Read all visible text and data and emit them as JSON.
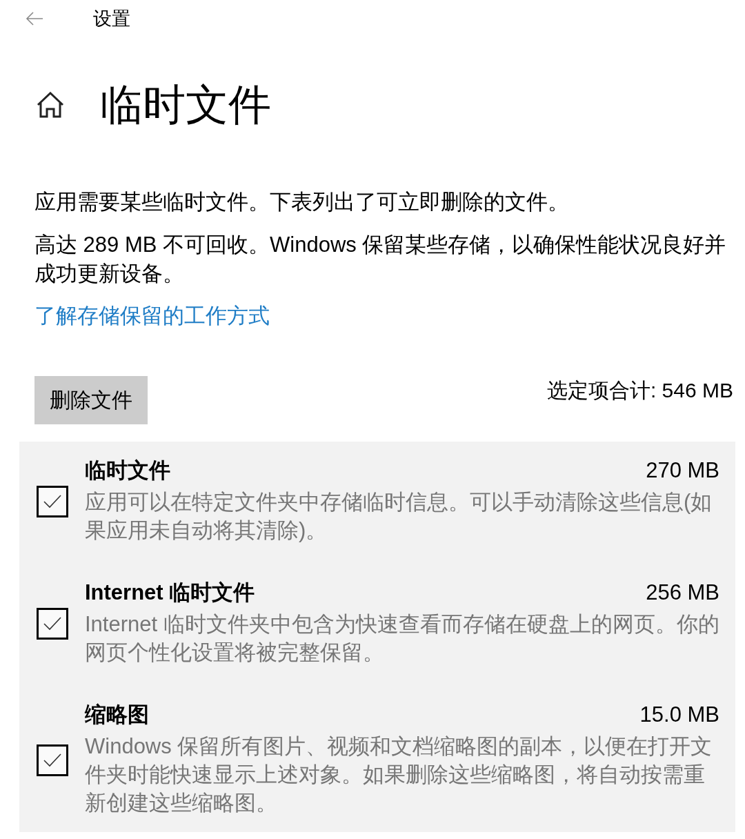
{
  "top_bar": {
    "title": "设置"
  },
  "page": {
    "title": "临时文件"
  },
  "intro": [
    "应用需要某些临时文件。下表列出了可立即删除的文件。",
    "高达 289 MB 不可回收。Windows 保留某些存储，以确保性能状况良好并成功更新设备。"
  ],
  "link": "了解存储保留的工作方式",
  "actions": {
    "button": "删除文件",
    "selected_total": "选定项合计: 546 MB"
  },
  "items": [
    {
      "title": "临时文件",
      "size": "270 MB",
      "description": "应用可以在特定文件夹中存储临时信息。可以手动清除这些信息(如果应用未自动将其清除)。",
      "checked": true
    },
    {
      "title": "Internet 临时文件",
      "size": "256 MB",
      "description": "Internet 临时文件夹中包含为快速查看而存储在硬盘上的网页。你的网页个性化设置将被完整保留。",
      "checked": true
    },
    {
      "title": "缩略图",
      "size": "15.0 MB",
      "description": "Windows 保留所有图片、视频和文档缩略图的副本，以便在打开文件夹时能快速显示上述对象。如果删除这些缩略图，将自动按需重新创建这些缩略图。",
      "checked": true
    }
  ]
}
